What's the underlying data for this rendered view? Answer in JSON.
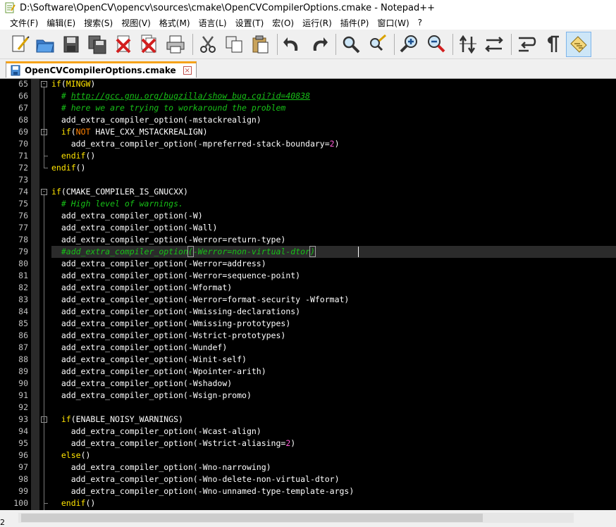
{
  "window": {
    "title": "D:\\Software\\OpenCV\\opencv\\sources\\cmake\\OpenCVCompilerOptions.cmake - Notepad++"
  },
  "menu": [
    {
      "label": "文件(F)"
    },
    {
      "label": "编辑(E)"
    },
    {
      "label": "搜索(S)"
    },
    {
      "label": "视图(V)"
    },
    {
      "label": "格式(M)"
    },
    {
      "label": "语言(L)"
    },
    {
      "label": "设置(T)"
    },
    {
      "label": "宏(O)"
    },
    {
      "label": "运行(R)"
    },
    {
      "label": "插件(P)"
    },
    {
      "label": "窗口(W)"
    },
    {
      "label": "?"
    }
  ],
  "toolbar": [
    {
      "name": "new-file-icon"
    },
    {
      "name": "open-file-icon"
    },
    {
      "name": "save-icon"
    },
    {
      "name": "save-all-icon"
    },
    {
      "name": "close-icon"
    },
    {
      "name": "close-all-icon"
    },
    {
      "name": "print-icon"
    },
    {
      "name": "cut-icon"
    },
    {
      "name": "copy-icon"
    },
    {
      "name": "paste-icon"
    },
    {
      "name": "undo-icon"
    },
    {
      "name": "redo-icon"
    },
    {
      "name": "find-icon"
    },
    {
      "name": "replace-icon"
    },
    {
      "name": "zoom-in-icon"
    },
    {
      "name": "zoom-out-icon"
    },
    {
      "name": "sync-vertical-scroll-icon"
    },
    {
      "name": "sync-horizontal-scroll-icon"
    },
    {
      "name": "word-wrap-icon"
    },
    {
      "name": "show-all-characters-icon"
    },
    {
      "name": "indent-guide-icon"
    }
  ],
  "tab": {
    "label": "OpenCVCompilerOptions.cmake",
    "close": "×"
  },
  "editor": {
    "colors": {
      "background": "#000000",
      "keyword": "#ffe400",
      "comment": "#17c117",
      "number": "#ff5ed7",
      "text": "#ffffff",
      "fold_accent": "#f5a31a"
    },
    "lines": [
      {
        "n": "65",
        "fold": "-",
        "tokens": [
          [
            "keyword",
            "if"
          ],
          [
            "default",
            "("
          ],
          [
            "keyword",
            "MINGW"
          ],
          [
            "default",
            ")"
          ]
        ]
      },
      {
        "n": "66",
        "tokens": [
          [
            "default",
            "  "
          ],
          [
            "comment",
            "# "
          ],
          [
            "link",
            "http://gcc.gnu.org/bugzilla/show_bug.cgi?id=40838"
          ]
        ]
      },
      {
        "n": "67",
        "tokens": [
          [
            "default",
            "  "
          ],
          [
            "comment",
            "# here we are trying to workaround the problem"
          ]
        ]
      },
      {
        "n": "68",
        "tokens": [
          [
            "default",
            "  add_extra_compiler_option(-mstackrealign)"
          ]
        ]
      },
      {
        "n": "69",
        "fold": "-",
        "tokens": [
          [
            "default",
            "  "
          ],
          [
            "keyword",
            "if"
          ],
          [
            "default",
            "("
          ],
          [
            "notkw",
            "NOT"
          ],
          [
            "default",
            " HAVE_CXX_MSTACKREALIGN)"
          ]
        ]
      },
      {
        "n": "70",
        "tokens": [
          [
            "default",
            "    add_extra_compiler_option(-mpreferred-stack-boundary="
          ],
          [
            "number",
            "2"
          ],
          [
            "default",
            ")"
          ]
        ]
      },
      {
        "n": "71",
        "tokens": [
          [
            "default",
            "  "
          ],
          [
            "keyword",
            "endif"
          ],
          [
            "default",
            "()"
          ]
        ]
      },
      {
        "n": "72",
        "tokens": [
          [
            "keyword",
            "endif"
          ],
          [
            "default",
            "()"
          ]
        ]
      },
      {
        "n": "73",
        "tokens": [
          [
            "default",
            ""
          ]
        ]
      },
      {
        "n": "74",
        "fold": "-",
        "tokens": [
          [
            "keyword",
            "if"
          ],
          [
            "default",
            "(CMAKE_COMPILER_IS_GNUCXX)"
          ]
        ]
      },
      {
        "n": "75",
        "tokens": [
          [
            "default",
            "  "
          ],
          [
            "comment",
            "# High level of warnings."
          ]
        ]
      },
      {
        "n": "76",
        "tokens": [
          [
            "default",
            "  add_extra_compiler_option(-W)"
          ]
        ]
      },
      {
        "n": "77",
        "tokens": [
          [
            "default",
            "  add_extra_compiler_option(-Wall)"
          ]
        ]
      },
      {
        "n": "78",
        "tokens": [
          [
            "default",
            "  add_extra_compiler_option(-Werror=return-type)"
          ]
        ]
      },
      {
        "n": "79",
        "highlight": true,
        "tokens": [
          [
            "default",
            "  "
          ],
          [
            "comment",
            "#add_extra_compiler_option"
          ],
          [
            "bracehl",
            "("
          ],
          [
            "comment",
            "-Werror=non-virtual-dtor"
          ],
          [
            "bracehl",
            ")"
          ]
        ]
      },
      {
        "n": "80",
        "tokens": [
          [
            "default",
            "  add_extra_compiler_option(-Werror=address)"
          ]
        ]
      },
      {
        "n": "81",
        "tokens": [
          [
            "default",
            "  add_extra_compiler_option(-Werror=sequence-point)"
          ]
        ]
      },
      {
        "n": "82",
        "tokens": [
          [
            "default",
            "  add_extra_compiler_option(-Wformat)"
          ]
        ]
      },
      {
        "n": "83",
        "tokens": [
          [
            "default",
            "  add_extra_compiler_option(-Werror=format-security -Wformat)"
          ]
        ]
      },
      {
        "n": "84",
        "tokens": [
          [
            "default",
            "  add_extra_compiler_option(-Wmissing-declarations)"
          ]
        ]
      },
      {
        "n": "85",
        "tokens": [
          [
            "default",
            "  add_extra_compiler_option(-Wmissing-prototypes)"
          ]
        ]
      },
      {
        "n": "86",
        "tokens": [
          [
            "default",
            "  add_extra_compiler_option(-Wstrict-prototypes)"
          ]
        ]
      },
      {
        "n": "87",
        "tokens": [
          [
            "default",
            "  add_extra_compiler_option(-Wundef)"
          ]
        ]
      },
      {
        "n": "88",
        "tokens": [
          [
            "default",
            "  add_extra_compiler_option(-Winit-self)"
          ]
        ]
      },
      {
        "n": "89",
        "tokens": [
          [
            "default",
            "  add_extra_compiler_option(-Wpointer-arith)"
          ]
        ]
      },
      {
        "n": "90",
        "tokens": [
          [
            "default",
            "  add_extra_compiler_option(-Wshadow)"
          ]
        ]
      },
      {
        "n": "91",
        "tokens": [
          [
            "default",
            "  add_extra_compiler_option(-Wsign-promo)"
          ]
        ]
      },
      {
        "n": "92",
        "tokens": [
          [
            "default",
            ""
          ]
        ]
      },
      {
        "n": "93",
        "fold": "-",
        "tokens": [
          [
            "default",
            "  "
          ],
          [
            "keyword",
            "if"
          ],
          [
            "default",
            "(ENABLE_NOISY_WARNINGS)"
          ]
        ]
      },
      {
        "n": "94",
        "tokens": [
          [
            "default",
            "    add_extra_compiler_option(-Wcast-align)"
          ]
        ]
      },
      {
        "n": "95",
        "tokens": [
          [
            "default",
            "    add_extra_compiler_option(-Wstrict-aliasing="
          ],
          [
            "number",
            "2"
          ],
          [
            "default",
            ")"
          ]
        ]
      },
      {
        "n": "96",
        "tokens": [
          [
            "default",
            "  "
          ],
          [
            "keyword",
            "else"
          ],
          [
            "default",
            "()"
          ]
        ]
      },
      {
        "n": "97",
        "tokens": [
          [
            "default",
            "    add_extra_compiler_option(-Wno-narrowing)"
          ]
        ]
      },
      {
        "n": "98",
        "tokens": [
          [
            "default",
            "    add_extra_compiler_option(-Wno-delete-non-virtual-dtor)"
          ]
        ]
      },
      {
        "n": "99",
        "tokens": [
          [
            "default",
            "    add_extra_compiler_option(-Wno-unnamed-type-template-args)"
          ]
        ]
      },
      {
        "n": "100",
        "tokens": [
          [
            "default",
            "  "
          ],
          [
            "keyword",
            "endif"
          ],
          [
            "default",
            "()"
          ]
        ]
      }
    ]
  },
  "status": {
    "partial_text": "2"
  }
}
